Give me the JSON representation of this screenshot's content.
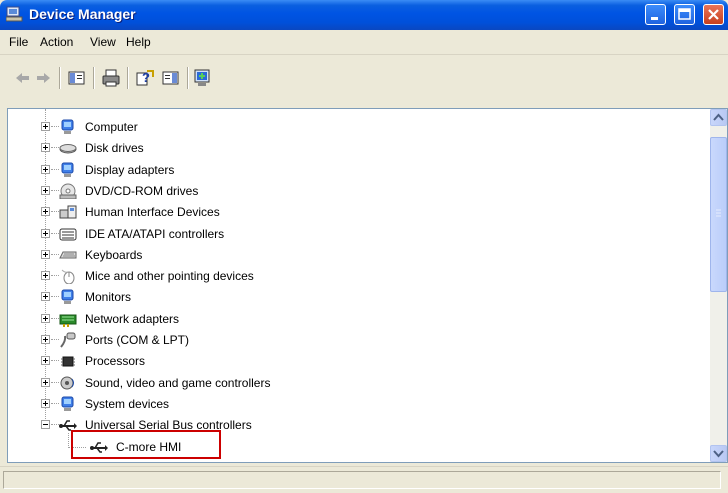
{
  "window": {
    "title": "Device Manager",
    "icon": "device-manager-icon"
  },
  "caption_buttons": [
    "minimize",
    "maximize",
    "close"
  ],
  "menu": [
    "File",
    "Action",
    "View",
    "Help"
  ],
  "toolbar": [
    "back-arrow-icon",
    "forward-arrow-icon",
    "show-hide-tree-icon",
    "print-icon",
    "help-icon",
    "properties-icon",
    "scan-hardware-icon"
  ],
  "tree": {
    "items": [
      {
        "label": "Computer",
        "icon": "computer-icon",
        "expanded": false
      },
      {
        "label": "Disk drives",
        "icon": "disk-drive-icon",
        "expanded": false
      },
      {
        "label": "Display adapters",
        "icon": "display-adapter-icon",
        "expanded": false
      },
      {
        "label": "DVD/CD-ROM drives",
        "icon": "dvd-drive-icon",
        "expanded": false
      },
      {
        "label": "Human Interface Devices",
        "icon": "hid-icon",
        "expanded": false
      },
      {
        "label": "IDE ATA/ATAPI controllers",
        "icon": "ide-controller-icon",
        "expanded": false
      },
      {
        "label": "Keyboards",
        "icon": "keyboard-icon",
        "expanded": false
      },
      {
        "label": "Mice and other pointing devices",
        "icon": "mouse-icon",
        "expanded": false
      },
      {
        "label": "Monitors",
        "icon": "monitor-icon",
        "expanded": false
      },
      {
        "label": "Network adapters",
        "icon": "network-adapter-icon",
        "expanded": false
      },
      {
        "label": "Ports (COM & LPT)",
        "icon": "port-icon",
        "expanded": false
      },
      {
        "label": "Processors",
        "icon": "processor-icon",
        "expanded": false
      },
      {
        "label": "Sound, video and game controllers",
        "icon": "sound-icon",
        "expanded": false
      },
      {
        "label": "System devices",
        "icon": "system-device-icon",
        "expanded": false
      },
      {
        "label": "Universal Serial Bus controllers",
        "icon": "usb-icon",
        "expanded": true
      }
    ],
    "children": [
      {
        "label": "C-more HMI",
        "icon": "usb-device-icon",
        "highlighted": true
      }
    ]
  },
  "colors": {
    "titlebar": "#0054e3",
    "highlight_border": "#cc0000",
    "window_bg": "#ece9d8"
  }
}
